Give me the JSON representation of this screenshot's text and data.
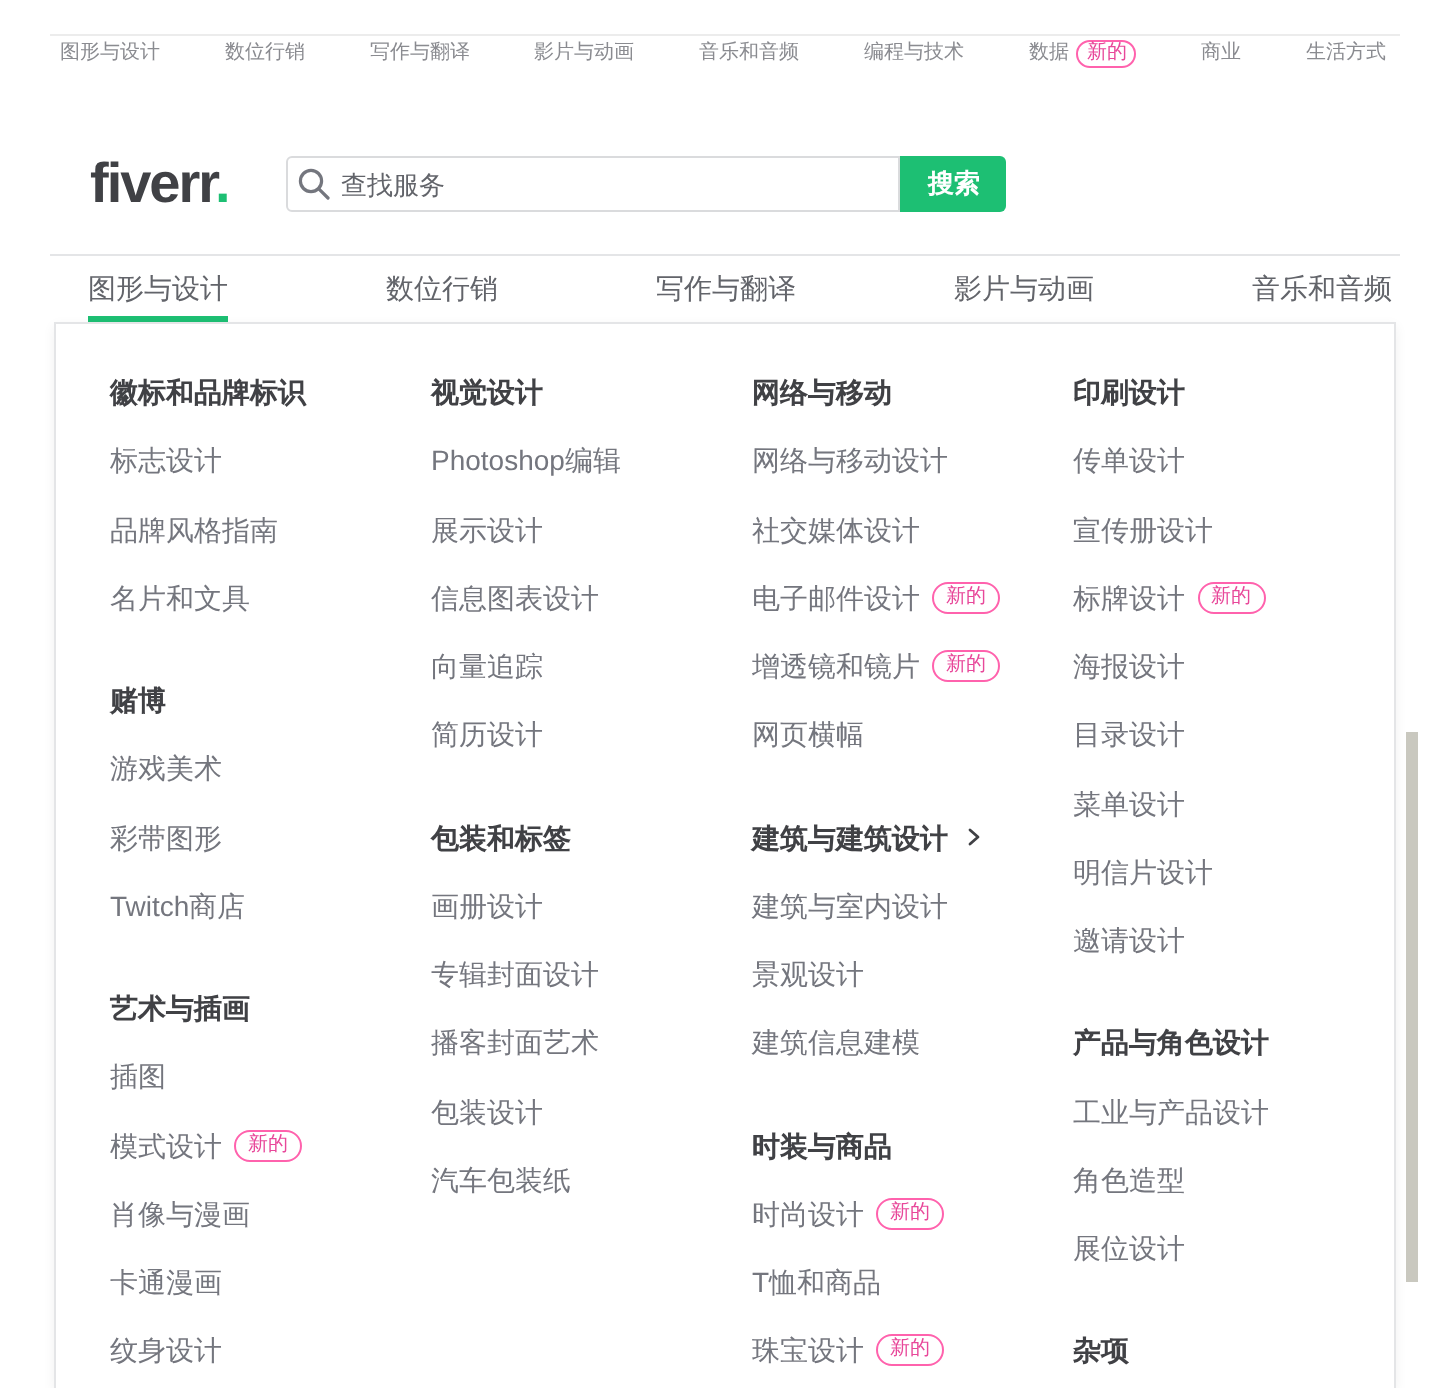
{
  "top_nav": {
    "items": [
      {
        "label": "图形与设计"
      },
      {
        "label": "数位行销"
      },
      {
        "label": "写作与翻译"
      },
      {
        "label": "影片与动画"
      },
      {
        "label": "音乐和音频"
      },
      {
        "label": "编程与技术"
      },
      {
        "label": "数据",
        "badge": "新的"
      },
      {
        "label": "商业"
      },
      {
        "label": "生活方式"
      }
    ]
  },
  "header": {
    "logo": {
      "text": "fiverr",
      "dot": "."
    },
    "search": {
      "placeholder": "查找服务",
      "button": "搜索"
    }
  },
  "category_tabs": [
    {
      "label": "图形与设计",
      "selected": true
    },
    {
      "label": "数位行销",
      "selected": false
    },
    {
      "label": "写作与翻译",
      "selected": false
    },
    {
      "label": "影片与动画",
      "selected": false
    },
    {
      "label": "音乐和音频",
      "selected": false
    }
  ],
  "menu": {
    "columns": [
      {
        "groups": [
          {
            "heading": "徽标和品牌标识",
            "submenu": false,
            "items": [
              {
                "label": "标志设计"
              },
              {
                "label": "品牌风格指南"
              },
              {
                "label": "名片和文具"
              }
            ]
          },
          {
            "heading": "赌博",
            "submenu": false,
            "items": [
              {
                "label": "游戏美术"
              },
              {
                "label": "彩带图形"
              },
              {
                "label": "Twitch商店"
              }
            ]
          },
          {
            "heading": "艺术与插画",
            "submenu": false,
            "items": [
              {
                "label": "插图"
              },
              {
                "label": "模式设计",
                "badge": "新的"
              },
              {
                "label": "肖像与漫画"
              },
              {
                "label": "卡通漫画"
              },
              {
                "label": "纹身设计"
              }
            ]
          }
        ]
      },
      {
        "groups": [
          {
            "heading": "视觉设计",
            "submenu": false,
            "items": [
              {
                "label": "Photoshop编辑"
              },
              {
                "label": "展示设计"
              },
              {
                "label": "信息图表设计"
              },
              {
                "label": "向量追踪"
              },
              {
                "label": "简历设计"
              }
            ]
          },
          {
            "heading": "包装和标签",
            "submenu": false,
            "items": [
              {
                "label": "画册设计"
              },
              {
                "label": "专辑封面设计"
              },
              {
                "label": "播客封面艺术"
              },
              {
                "label": "包装设计"
              },
              {
                "label": "汽车包装纸"
              }
            ]
          }
        ]
      },
      {
        "groups": [
          {
            "heading": "网络与移动",
            "submenu": false,
            "items": [
              {
                "label": "网络与移动设计"
              },
              {
                "label": "社交媒体设计"
              },
              {
                "label": "电子邮件设计",
                "badge": "新的"
              },
              {
                "label": "增透镜和镜片",
                "badge": "新的"
              },
              {
                "label": "网页横幅"
              }
            ]
          },
          {
            "heading": "建筑与建筑设计",
            "submenu": true,
            "items": [
              {
                "label": "建筑与室内设计"
              },
              {
                "label": "景观设计"
              },
              {
                "label": "建筑信息建模"
              }
            ]
          },
          {
            "heading": "时装与商品",
            "submenu": false,
            "items": [
              {
                "label": "时尚设计",
                "badge": "新的"
              },
              {
                "label": "T恤和商品"
              },
              {
                "label": "珠宝设计",
                "badge": "新的"
              }
            ]
          }
        ]
      },
      {
        "groups": [
          {
            "heading": "印刷设计",
            "submenu": false,
            "items": [
              {
                "label": "传单设计"
              },
              {
                "label": "宣传册设计"
              },
              {
                "label": "标牌设计",
                "badge": "新的"
              },
              {
                "label": "海报设计"
              },
              {
                "label": "目录设计"
              },
              {
                "label": "菜单设计"
              },
              {
                "label": "明信片设计"
              },
              {
                "label": "邀请设计"
              }
            ]
          },
          {
            "heading": "产品与角色设计",
            "submenu": false,
            "items": [
              {
                "label": "工业与产品设计"
              },
              {
                "label": "角色造型"
              },
              {
                "label": "展位设计"
              }
            ]
          },
          {
            "heading": "杂项",
            "submenu": false
          }
        ]
      }
    ]
  }
}
